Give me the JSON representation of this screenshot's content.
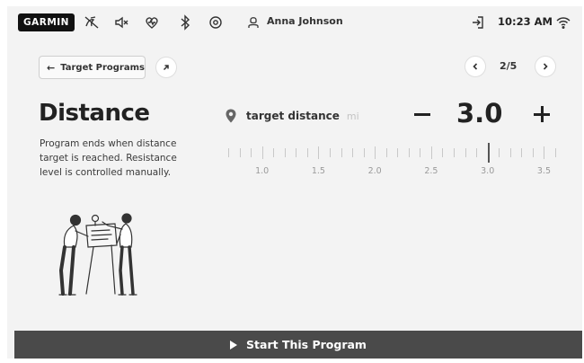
{
  "status_bar": {
    "brand": "GARMIN",
    "icons": [
      "hide-stats-icon",
      "sound-off-icon",
      "heart-rate-icon",
      "bluetooth-icon",
      "settings-icon",
      "user-icon",
      "logout-icon",
      "wifi-icon"
    ],
    "user_name": "Anna Johnson",
    "time": "10:23 AM"
  },
  "header": {
    "back_label": "Target Programs",
    "pager": "2/5"
  },
  "program": {
    "title": "Distance",
    "description": "Program ends when distance target is reached. Resistance level is controlled manually."
  },
  "target": {
    "label": "target distance",
    "unit": "mi",
    "value": "3.0",
    "ruler_labels": [
      "1.0",
      "1.5",
      "2.0",
      "2.5",
      "3.0",
      "3.5"
    ],
    "range": [
      0.7,
      3.6
    ],
    "selected": 3.0
  },
  "footer": {
    "start_label": "Start This Program"
  },
  "colors": {
    "background": "#f3f3f3",
    "button_dark": "#4a4a4a",
    "text": "#222222"
  }
}
